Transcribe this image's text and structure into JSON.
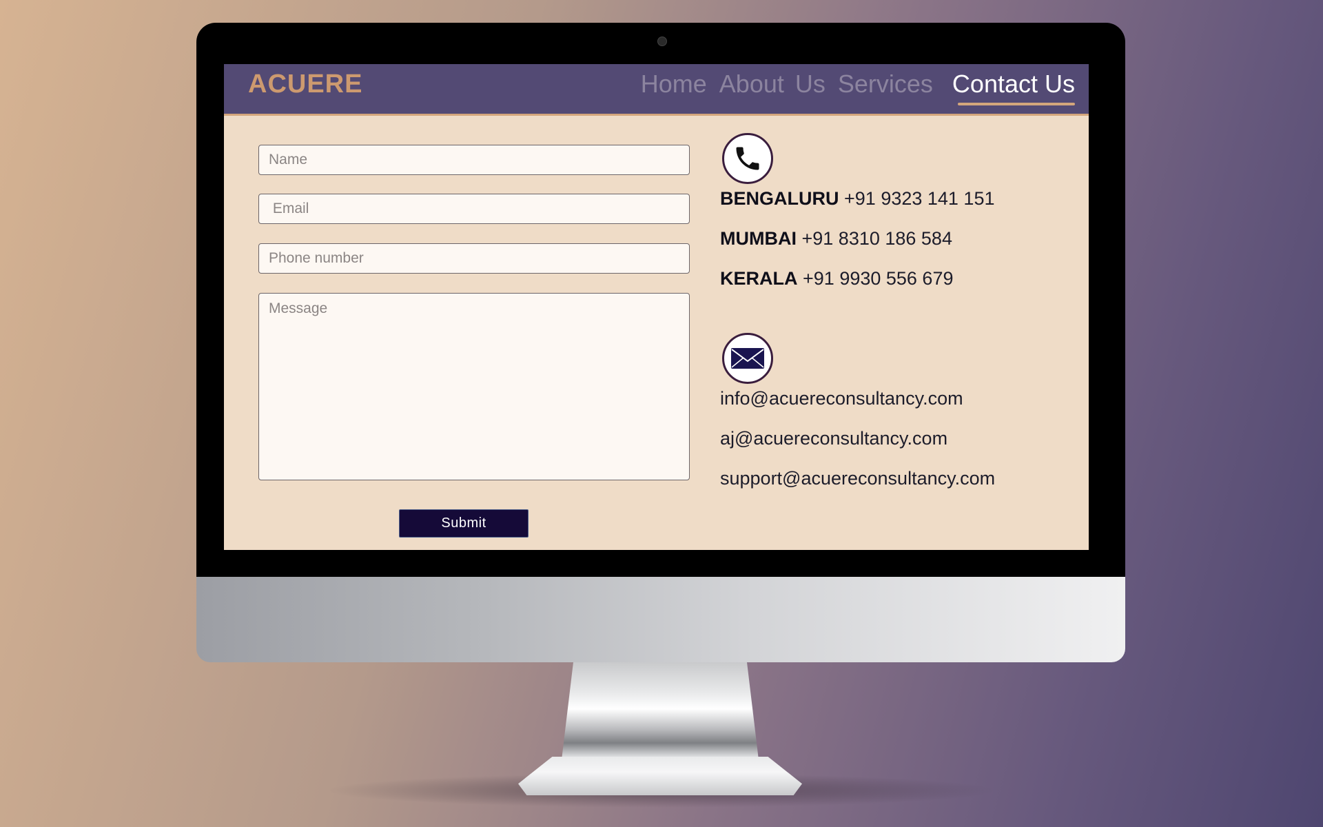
{
  "site": {
    "logo": "ACUERE"
  },
  "nav": {
    "items": [
      {
        "label": "Home"
      },
      {
        "label": "About"
      },
      {
        "label": "Us"
      },
      {
        "label": "Services"
      },
      {
        "label": "Contact Us",
        "active": true
      }
    ]
  },
  "form": {
    "name_placeholder": "Name",
    "email_placeholder": " Email",
    "phone_placeholder": "Phone number",
    "message_placeholder": "Message",
    "submit_label": "Submit"
  },
  "contact": {
    "phone_icon": "phone-icon",
    "phones": [
      {
        "city": "BENGALURU",
        "number": "+91 9323 141 151"
      },
      {
        "city": "MUMBAI",
        "number": "+91 8310 186 584"
      },
      {
        "city": "KERALA",
        "number": "+91 9930 556 679"
      }
    ],
    "email_icon": "mail-icon",
    "emails": [
      "info@acuereconsultancy.com",
      "aj@acuereconsultancy.com",
      "support@acuereconsultancy.com"
    ]
  },
  "colors": {
    "navbar": "#534a74",
    "accent": "#cd9a6f",
    "page_bg": "#efdcc7",
    "button_bg": "#150a38"
  }
}
